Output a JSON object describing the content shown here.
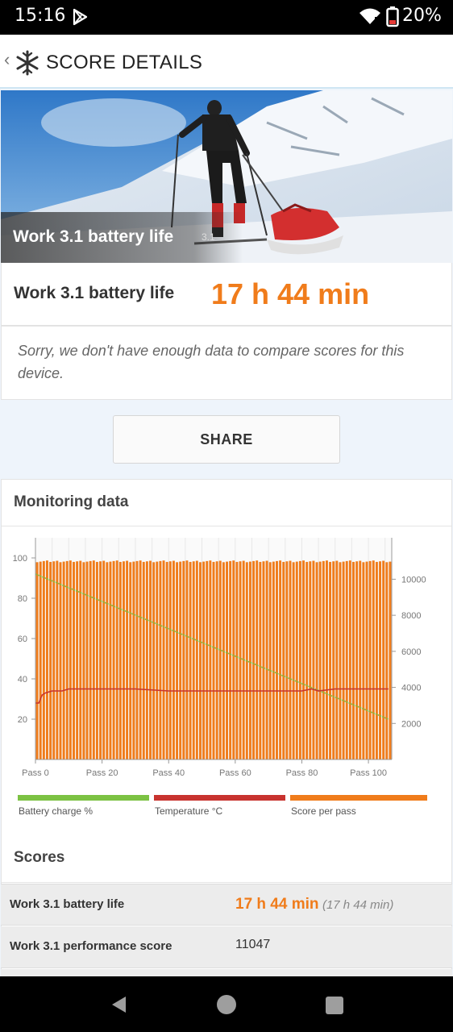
{
  "status_bar": {
    "time": "15:16",
    "battery_percent": "20%"
  },
  "app_bar": {
    "title": "SCORE DETAILS"
  },
  "hero": {
    "caption": "Work 3.1 battery life",
    "version": "3.1"
  },
  "score": {
    "label": "Work 3.1 battery life",
    "value": "17 h 44 min"
  },
  "notice": "Sorry, we don't have enough data to compare scores for this device.",
  "share_label": "SHARE",
  "monitoring": {
    "heading": "Monitoring data"
  },
  "chart_data": {
    "type": "bar",
    "left_axis_ticks": [
      "100",
      "80",
      "60",
      "40",
      "20"
    ],
    "right_axis_ticks": [
      "10000",
      "8000",
      "6000",
      "4000",
      "2000"
    ],
    "x_ticks": [
      "Pass 0",
      "Pass 20",
      "Pass 40",
      "Pass 60",
      "Pass 80",
      "Pass 100"
    ],
    "left_ylim": [
      0,
      110
    ],
    "right_ylim": [
      0,
      12300
    ],
    "xlim": [
      0,
      107
    ],
    "series": [
      {
        "name": "Battery charge %",
        "color": "#7cc243",
        "style": "line",
        "axis": "left",
        "start": 92,
        "end": 20
      },
      {
        "name": "Temperature °C",
        "color": "#c8332f",
        "style": "line",
        "axis": "left",
        "points": [
          [
            0,
            28
          ],
          [
            1,
            28
          ],
          [
            2,
            32
          ],
          [
            3,
            33
          ],
          [
            5,
            34
          ],
          [
            8,
            34
          ],
          [
            10,
            35
          ],
          [
            14,
            35
          ],
          [
            20,
            35
          ],
          [
            30,
            35
          ],
          [
            40,
            34
          ],
          [
            60,
            34
          ],
          [
            80,
            34
          ],
          [
            83,
            35
          ],
          [
            85,
            34
          ],
          [
            90,
            35
          ],
          [
            100,
            35
          ],
          [
            106,
            35
          ]
        ]
      },
      {
        "name": "Score per pass",
        "color": "#f07c1b",
        "style": "bars",
        "axis": "right",
        "count": 107,
        "typical": 11000
      }
    ]
  },
  "scores": {
    "heading": "Scores",
    "rows": [
      {
        "label": "Work 3.1 battery life",
        "value": "17 h 44 min",
        "sub": "(17 h 44 min)"
      },
      {
        "label": "Work 3.1 performance score",
        "value": "11047"
      }
    ]
  },
  "colors": {
    "accent": "#f07c1b",
    "battery": "#7cc243",
    "temperature": "#c8332f"
  }
}
